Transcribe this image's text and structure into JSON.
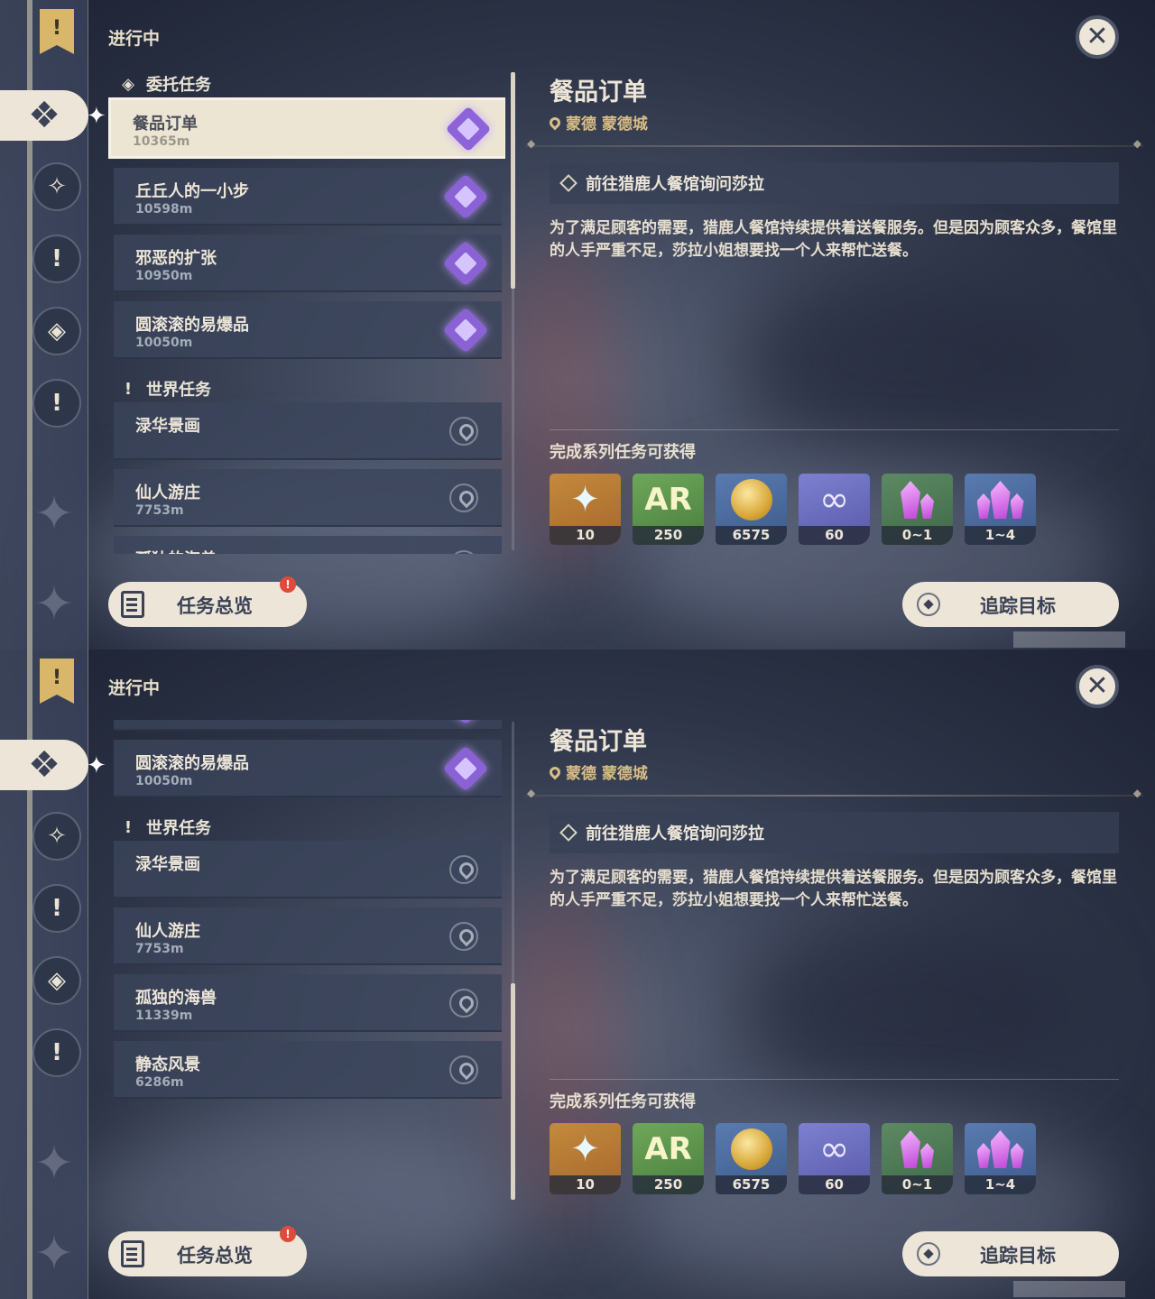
{
  "screens": [
    {
      "header": "进行中",
      "categories": [
        {
          "title": "委托任务",
          "items": [
            {
              "name": "餐品订单",
              "dist": "10365m",
              "active": true
            },
            {
              "name": "丘丘人的一小步",
              "dist": "10598m"
            },
            {
              "name": "邪恶的扩张",
              "dist": "10950m"
            },
            {
              "name": "圆滚滚的易爆品",
              "dist": "10050m"
            }
          ]
        },
        {
          "title": "世界任务",
          "items": [
            {
              "name": "渌华景画",
              "dist": ""
            },
            {
              "name": "仙人游庄",
              "dist": "7753m"
            },
            {
              "name": "孤独的海兽",
              "dist": ""
            }
          ]
        }
      ],
      "list_scroll": 0,
      "scroll_fraction": 0.0
    },
    {
      "header": "进行中",
      "categories": [
        {
          "title": "委托任务",
          "items": [
            {
              "name": "餐品订单",
              "dist": "10365m",
              "active": true
            },
            {
              "name": "丘丘人的一小步",
              "dist": "10598m"
            },
            {
              "name": "邪恶的扩张",
              "dist": "10950m"
            },
            {
              "name": "圆滚滚的易爆品",
              "dist": "10050m"
            }
          ]
        },
        {
          "title": "世界任务",
          "items": [
            {
              "name": "渌华景画",
              "dist": ""
            },
            {
              "name": "仙人游庄",
              "dist": "7753m"
            },
            {
              "name": "孤独的海兽",
              "dist": "11339m"
            },
            {
              "name": "静态风景",
              "dist": "6286m"
            }
          ]
        }
      ],
      "list_scroll": 1,
      "scroll_fraction": 1.0
    }
  ],
  "detail": {
    "title": "餐品订单",
    "location": "蒙德 蒙德城",
    "objective": "前往猎鹿人餐馆询问莎拉",
    "description": "为了满足顾客的需要，猎鹿人餐馆持续提供着送餐服务。但是因为顾客众多，餐馆里的人手严重不足，莎拉小姐想要找一个人来帮忙送餐。",
    "rewards_title": "完成系列任务可获得",
    "rewards": [
      {
        "icon": "primogem-icon",
        "count": "10"
      },
      {
        "icon": "adventure-exp-icon",
        "count": "250"
      },
      {
        "icon": "mora-icon",
        "count": "6575"
      },
      {
        "icon": "companionship-exp-icon",
        "count": "60"
      },
      {
        "icon": "crystal-chunk-icon",
        "count": "0~1"
      },
      {
        "icon": "crystal-ore-icon",
        "count": "1~4"
      }
    ]
  },
  "buttons": {
    "overview": "任务总览",
    "track": "追踪目标",
    "close_glyph": "✕"
  },
  "rail": {
    "banner_glyph": "!",
    "icons": [
      "commission-icon",
      "archon-quest-icon",
      "world-quest-icon",
      "story-quest-icon",
      "event-quest-icon"
    ]
  }
}
